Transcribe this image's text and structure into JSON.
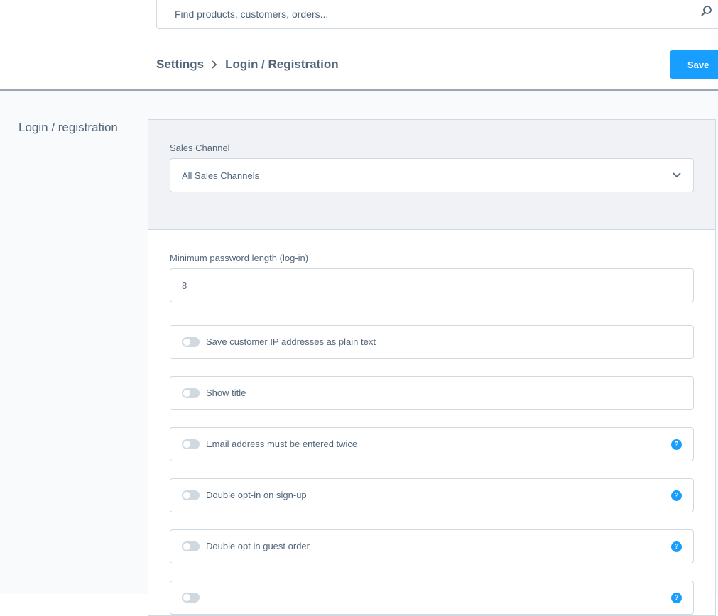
{
  "search": {
    "placeholder": "Find products, customers, orders..."
  },
  "breadcrumb": {
    "parent": "Settings",
    "current": "Login / Registration"
  },
  "toolbar": {
    "save_label": "Save"
  },
  "section": {
    "title": "Login / registration"
  },
  "sales_channel": {
    "label": "Sales Channel",
    "selected": "All Sales Channels"
  },
  "min_password": {
    "label": "Minimum password length (log-in)",
    "value": "8"
  },
  "toggles": [
    {
      "label": "Save customer IP addresses as plain text",
      "help": false,
      "enabled": false
    },
    {
      "label": "Show title",
      "help": false,
      "enabled": false
    },
    {
      "label": "Email address must be entered twice",
      "help": true,
      "enabled": false
    },
    {
      "label": "Double opt-in on sign-up",
      "help": true,
      "enabled": false
    },
    {
      "label": "Double opt in guest order",
      "help": true,
      "enabled": false
    },
    {
      "label": "",
      "help": true,
      "enabled": false
    }
  ],
  "help_glyph": "?",
  "colors": {
    "accent": "#189eff",
    "text": "#52667a",
    "border": "#d1d9e0"
  }
}
